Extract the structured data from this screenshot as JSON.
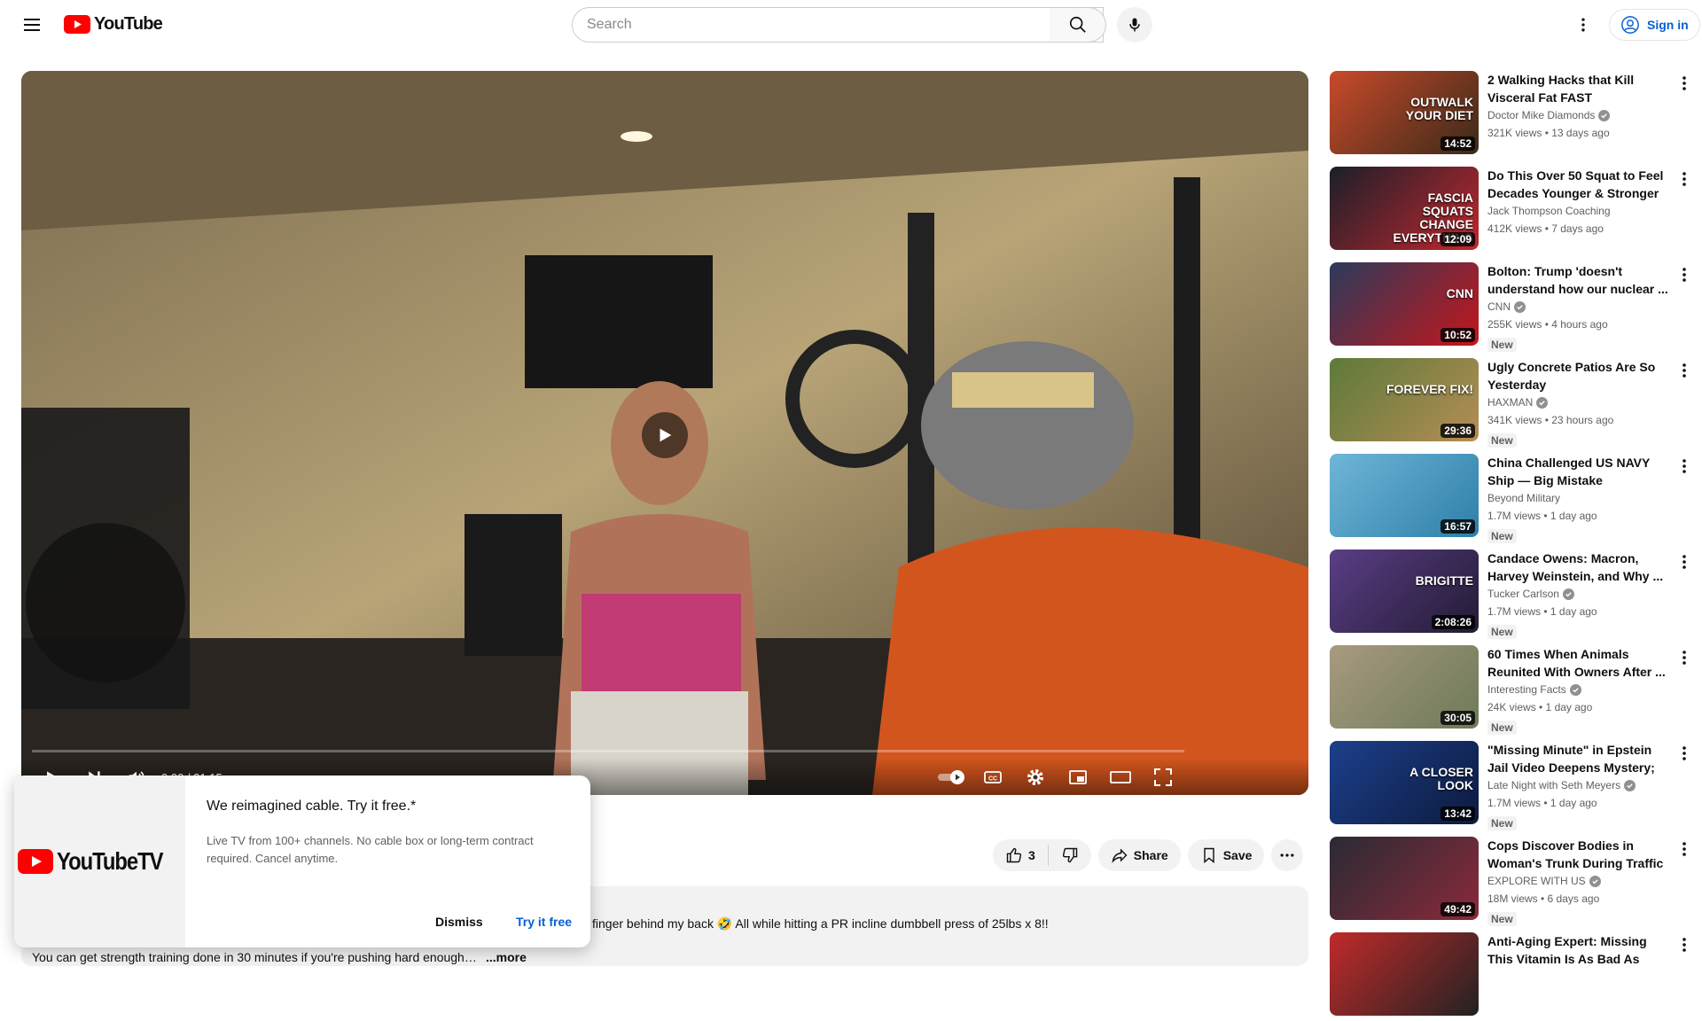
{
  "header": {
    "logo_text": "YouTube",
    "search_placeholder": "Search",
    "signin_label": "Sign in"
  },
  "player": {
    "time": "0:00 / 31:15",
    "progress": 0
  },
  "actions": {
    "like_count": "3",
    "share_label": "Share",
    "save_label": "Save"
  },
  "description": {
    "line1": "finger behind my back 🤣 All while hitting a PR incline dumbbell press of 25lbs x 8!!",
    "line2": "You can get strength training done in 30 minutes if you're pushing hard enough…",
    "more_label": "...more"
  },
  "promo": {
    "logo_text": "YouTubeTV",
    "title": "We reimagined cable. Try it free.*",
    "body": "Live TV from 100+ channels. No cable box or long-term contract required. Cancel anytime.",
    "dismiss_label": "Dismiss",
    "try_label": "Try it free"
  },
  "recommendations": [
    {
      "title": "2 Walking Hacks that Kill Visceral Fat FAST",
      "channel": "Doctor Mike Diamonds",
      "verified": true,
      "meta": "321K views • 13 days ago",
      "duration": "14:52",
      "is_new": false,
      "thumb_text": "OUTWALK YOUR DIET",
      "thumb_colors": [
        "#c94a2a",
        "#3a2a1a"
      ]
    },
    {
      "title": "Do This Over 50 Squat to Feel Decades Younger & Stronger",
      "channel": "Jack Thompson Coaching",
      "verified": false,
      "meta": "412K views • 7 days ago",
      "duration": "12:09",
      "is_new": false,
      "thumb_text": "FASCIA SQUATS CHANGE EVERYTHING",
      "thumb_colors": [
        "#1b1f2a",
        "#c1272d"
      ]
    },
    {
      "title": "Bolton: Trump 'doesn't understand how our nuclear ...",
      "channel": "CNN",
      "verified": true,
      "meta": "255K views • 4 hours ago",
      "duration": "10:52",
      "is_new": true,
      "thumb_text": "CNN",
      "thumb_colors": [
        "#2b3b5b",
        "#c4161c"
      ]
    },
    {
      "title": "Ugly Concrete Patios Are So Yesterday",
      "channel": "HAXMAN",
      "verified": true,
      "meta": "341K views • 23 hours ago",
      "duration": "29:36",
      "is_new": true,
      "thumb_text": "FOREVER FIX!",
      "thumb_colors": [
        "#5d7a3a",
        "#b58d55"
      ]
    },
    {
      "title": "China Challenged US NAVY Ship — Big Mistake",
      "channel": "Beyond Military",
      "verified": false,
      "meta": "1.7M views • 1 day ago",
      "duration": "16:57",
      "is_new": true,
      "thumb_text": "",
      "thumb_colors": [
        "#6fb6d8",
        "#2e7fa8"
      ]
    },
    {
      "title": "Candace Owens: Macron, Harvey Weinstein, and Why ...",
      "channel": "Tucker Carlson",
      "verified": true,
      "meta": "1.7M views • 1 day ago",
      "duration": "2:08:26",
      "is_new": true,
      "thumb_text": "BRIGITTE",
      "thumb_colors": [
        "#5a3e86",
        "#231b33"
      ]
    },
    {
      "title": "60 Times When Animals Reunited With Owners After ...",
      "channel": "Interesting Facts",
      "verified": true,
      "meta": "24K views • 1 day ago",
      "duration": "30:05",
      "is_new": true,
      "thumb_text": "",
      "thumb_colors": [
        "#a89a80",
        "#6d7a58"
      ]
    },
    {
      "title": "\"Missing Minute\" in Epstein Jail Video Deepens Mystery; Trum...",
      "channel": "Late Night with Seth Meyers",
      "verified": true,
      "meta": "1.7M views • 1 day ago",
      "duration": "13:42",
      "is_new": true,
      "thumb_text": "A CLOSER LOOK",
      "thumb_colors": [
        "#1d3f8c",
        "#0c1b3d"
      ]
    },
    {
      "title": "Cops Discover Bodies in Woman's Trunk During Traffic ...",
      "channel": "EXPLORE WITH US",
      "verified": true,
      "meta": "18M views • 6 days ago",
      "duration": "49:42",
      "is_new": true,
      "thumb_text": "",
      "thumb_colors": [
        "#2a2a35",
        "#8a2a3a"
      ]
    },
    {
      "title": "Anti-Aging Expert: Missing This Vitamin Is As Bad As Smoking...",
      "channel": "",
      "verified": false,
      "meta": "",
      "duration": "",
      "is_new": false,
      "thumb_text": "",
      "thumb_colors": [
        "#c12a2a",
        "#222"
      ]
    }
  ],
  "colors": {
    "brand_red": "#ff0000",
    "link_blue": "#065fd4"
  }
}
